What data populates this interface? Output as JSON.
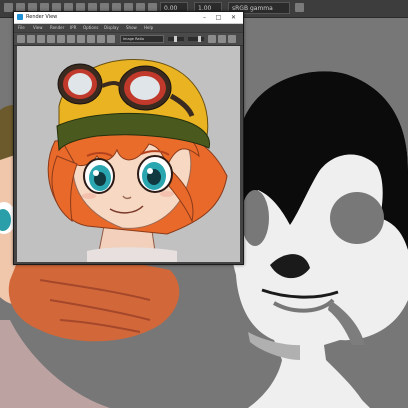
{
  "toolbar": {
    "field_1": "0.00",
    "field_2": "1.00",
    "color_space": "sRGB gamma"
  },
  "render_view": {
    "title": "Render View",
    "minimize_glyph": "–",
    "maximize_glyph": "□",
    "close_glyph": "✕",
    "menus": [
      "File",
      "View",
      "Render",
      "IPR",
      "Options",
      "Display",
      "Show",
      "Help"
    ],
    "aspect_option": "Image Ratio"
  },
  "colors": {
    "maya_panel": "#444444",
    "render_background": "#c1c1c1",
    "viewport_background": "#777777",
    "hair": "#e8692a",
    "helmet": "#4a5a1e",
    "goggle_strap": "#e9b321",
    "goggle_lens_frame": "#c0392b",
    "eye_iris": "#2aa6b0"
  }
}
